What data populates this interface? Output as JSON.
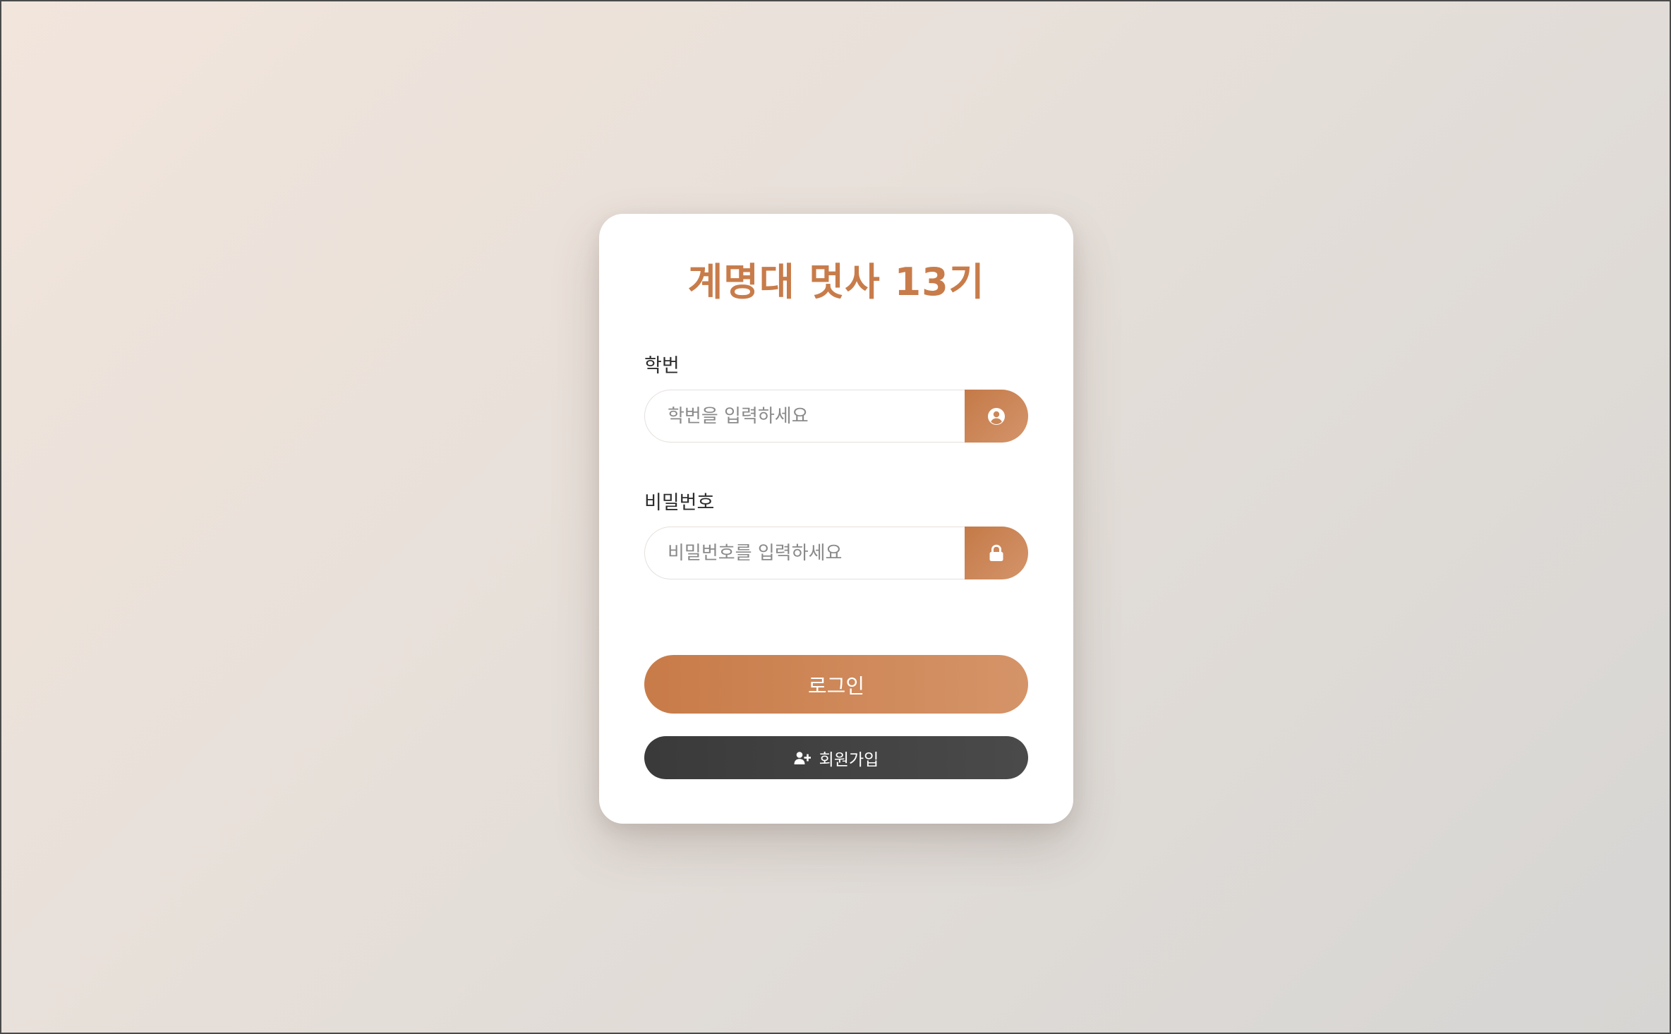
{
  "login_card": {
    "title": "계명대 멋사 13기",
    "student_id": {
      "label": "학번",
      "placeholder": "학번을 입력하세요",
      "value": "",
      "icon": "user-circle-icon"
    },
    "password": {
      "label": "비밀번호",
      "placeholder": "비밀번호를 입력하세요",
      "value": "",
      "icon": "lock-icon"
    },
    "login_button": "로그인",
    "signup_button": {
      "label": "회원가입",
      "icon": "user-plus-icon"
    }
  },
  "colors": {
    "accent": "#c87c4a",
    "accent_light": "#d4946a",
    "dark_button": "#3d3d3d",
    "card_background": "#ffffff"
  }
}
